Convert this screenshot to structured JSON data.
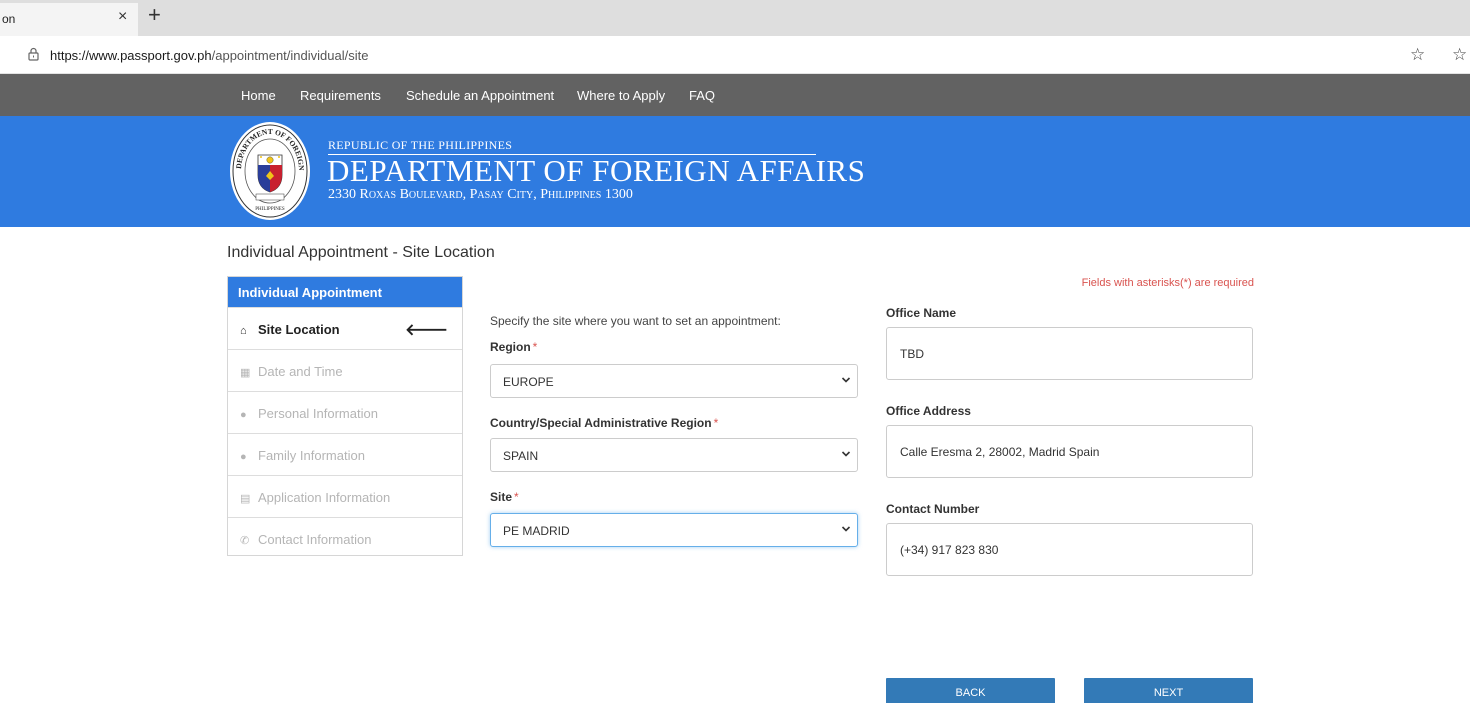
{
  "browser": {
    "tab_title": "on",
    "tab_close": "×",
    "new_tab": "+",
    "url_host": "https://www.passport.gov.ph",
    "url_path": "/appointment/individual/site",
    "favorite_icon": "☆",
    "favorites_list_icon": "☆"
  },
  "nav": {
    "items": [
      "Home",
      "Requirements",
      "Schedule an Appointment",
      "Where to Apply",
      "FAQ"
    ]
  },
  "banner": {
    "small": "REPUBLIC OF THE PHILIPPINES",
    "title": "DEPARTMENT OF FOREIGN AFFAIRS",
    "address": "2330 Roxas Boulevard, Pasay City, Philippines 1300",
    "seal_top": "DEPARTMENT OF FOREIGN AFFAIRS",
    "seal_bottom": "PHILIPPINES"
  },
  "page": {
    "title": "Individual Appointment - Site Location",
    "required_note": "Fields with asterisks(*) are required"
  },
  "sidebar": {
    "heading": "Individual Appointment",
    "items": [
      {
        "icon": "home-icon",
        "label": "Site Location",
        "active": true
      },
      {
        "icon": "calendar-icon",
        "label": "Date and Time",
        "active": false
      },
      {
        "icon": "user-icon",
        "label": "Personal Information",
        "active": false
      },
      {
        "icon": "users-icon",
        "label": "Family Information",
        "active": false
      },
      {
        "icon": "list-icon",
        "label": "Application Information",
        "active": false
      },
      {
        "icon": "phone-icon",
        "label": "Contact Information",
        "active": false
      }
    ],
    "active_arrow": "🡐"
  },
  "form": {
    "instruction": "Specify the site where you want to set an appointment:",
    "asterisk": "*",
    "region": {
      "label": "Region",
      "value": "EUROPE"
    },
    "country": {
      "label": "Country/Special Administrative Region",
      "value": "SPAIN"
    },
    "site": {
      "label": "Site",
      "value": "PE MADRID"
    }
  },
  "office": {
    "name_label": "Office Name",
    "name": "TBD",
    "address_label": "Office Address",
    "address": "Calle Eresma 2, 28002, Madrid Spain",
    "contact_label": "Contact Number",
    "contact": "(+34) 917 823 830"
  },
  "buttons": {
    "back": "BACK",
    "next": "NEXT"
  },
  "colors": {
    "banner": "#2f7be0",
    "nav": "#626262",
    "button": "#337ab7",
    "required": "#d9534f"
  }
}
